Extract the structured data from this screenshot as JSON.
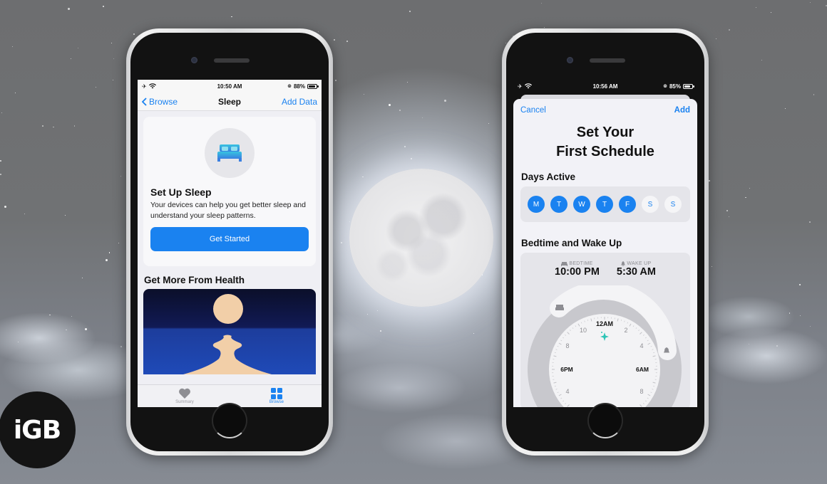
{
  "background": {
    "scene": "night sky with full moon and clouds",
    "logo_text": "iGB"
  },
  "left_phone": {
    "status_bar": {
      "time": "10:50 AM",
      "battery": "88%",
      "battery_fraction": 0.88,
      "left_icons": [
        "airplane-icon",
        "wifi-icon"
      ],
      "right_icons": [
        "orientation-lock-icon",
        "battery-icon"
      ]
    },
    "nav": {
      "back_label": "Browse",
      "title": "Sleep",
      "action_label": "Add Data"
    },
    "setup_card": {
      "icon": "bed-icon",
      "title": "Set Up Sleep",
      "description": "Your devices can help you get better sleep and understand your sleep patterns.",
      "button_label": "Get Started"
    },
    "section_title": "Get More From Health",
    "tab_bar": {
      "tabs": [
        {
          "label": "Summary",
          "icon": "heart-icon",
          "active": false
        },
        {
          "label": "Browse",
          "icon": "grid-icon",
          "active": true
        }
      ]
    }
  },
  "right_phone": {
    "status_bar": {
      "time": "10:56 AM",
      "battery": "85%",
      "battery_fraction": 0.85,
      "left_icons": [
        "airplane-icon",
        "wifi-icon"
      ],
      "right_icons": [
        "orientation-lock-icon",
        "battery-icon"
      ]
    },
    "sheet_nav": {
      "cancel_label": "Cancel",
      "add_label": "Add"
    },
    "title_line1": "Set Your",
    "title_line2": "First Schedule",
    "days_section": {
      "title": "Days Active",
      "days": [
        {
          "label": "M",
          "active": true
        },
        {
          "label": "T",
          "active": true
        },
        {
          "label": "W",
          "active": true
        },
        {
          "label": "T",
          "active": true
        },
        {
          "label": "F",
          "active": true
        },
        {
          "label": "S",
          "active": false
        },
        {
          "label": "S",
          "active": false
        }
      ]
    },
    "bedtime_section": {
      "title": "Bedtime and Wake Up",
      "bedtime_label": "BEDTIME",
      "bedtime_value": "10:00 PM",
      "wake_label": "WAKE UP",
      "wake_value": "5:30 AM",
      "clock_labels": {
        "top": "12AM",
        "left": "6PM",
        "right": "6AM",
        "n10": "10",
        "n2": "2",
        "n8l": "8",
        "n4r": "4",
        "n4l": "4",
        "n8r": "8"
      }
    }
  },
  "colors": {
    "accent": "#1a82f0",
    "sleep_icon_gradient": [
      "#37c3e0",
      "#3a7fe0"
    ],
    "sparkle": "#2ec4b6"
  }
}
